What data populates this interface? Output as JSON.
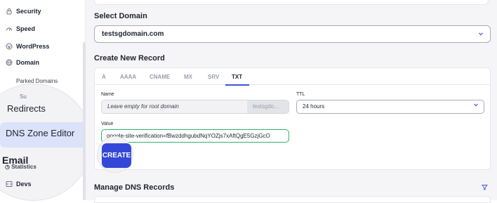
{
  "sidebar": {
    "items": [
      {
        "label": "Security",
        "icon": "lock-icon"
      },
      {
        "label": "Speed",
        "icon": "speed-icon"
      },
      {
        "label": "WordPress",
        "icon": "wordpress-icon"
      },
      {
        "label": "Domain",
        "icon": "globe-icon"
      }
    ],
    "sub_items": [
      "Parked Domains"
    ],
    "lens": {
      "sub_cut": "Su",
      "redirects": "Redirects",
      "dns_zone_editor": "DNS Zone Editor",
      "email": "Email",
      "statistics": "Statistics"
    },
    "devs": {
      "label": "Devs",
      "icon": "code-icon"
    }
  },
  "main": {
    "select_domain_title": "Select Domain",
    "domain_value": "testsgdomain.com",
    "create_record_title": "Create New Record",
    "tabs": [
      "A",
      "AAAA",
      "CNAME",
      "MX",
      "SRV",
      "TXT"
    ],
    "active_tab": "TXT",
    "name_label": "Name",
    "name_placeholder": "Leave empty for root domain",
    "name_suffix": "testsgdo...",
    "ttl_label": "TTL",
    "ttl_value": "24 hours",
    "value_label": "Value",
    "value_text": "google-site-verification=fBwzddhgubdNqYOZjs7xAftQgE5GzjGcO",
    "create_label": "CREATE",
    "manage_title": "Manage DNS Records"
  },
  "colors": {
    "accent": "#3d53d7",
    "button": "#3448d8",
    "success_border": "#2db36b",
    "highlight": "#dbe3fb"
  }
}
